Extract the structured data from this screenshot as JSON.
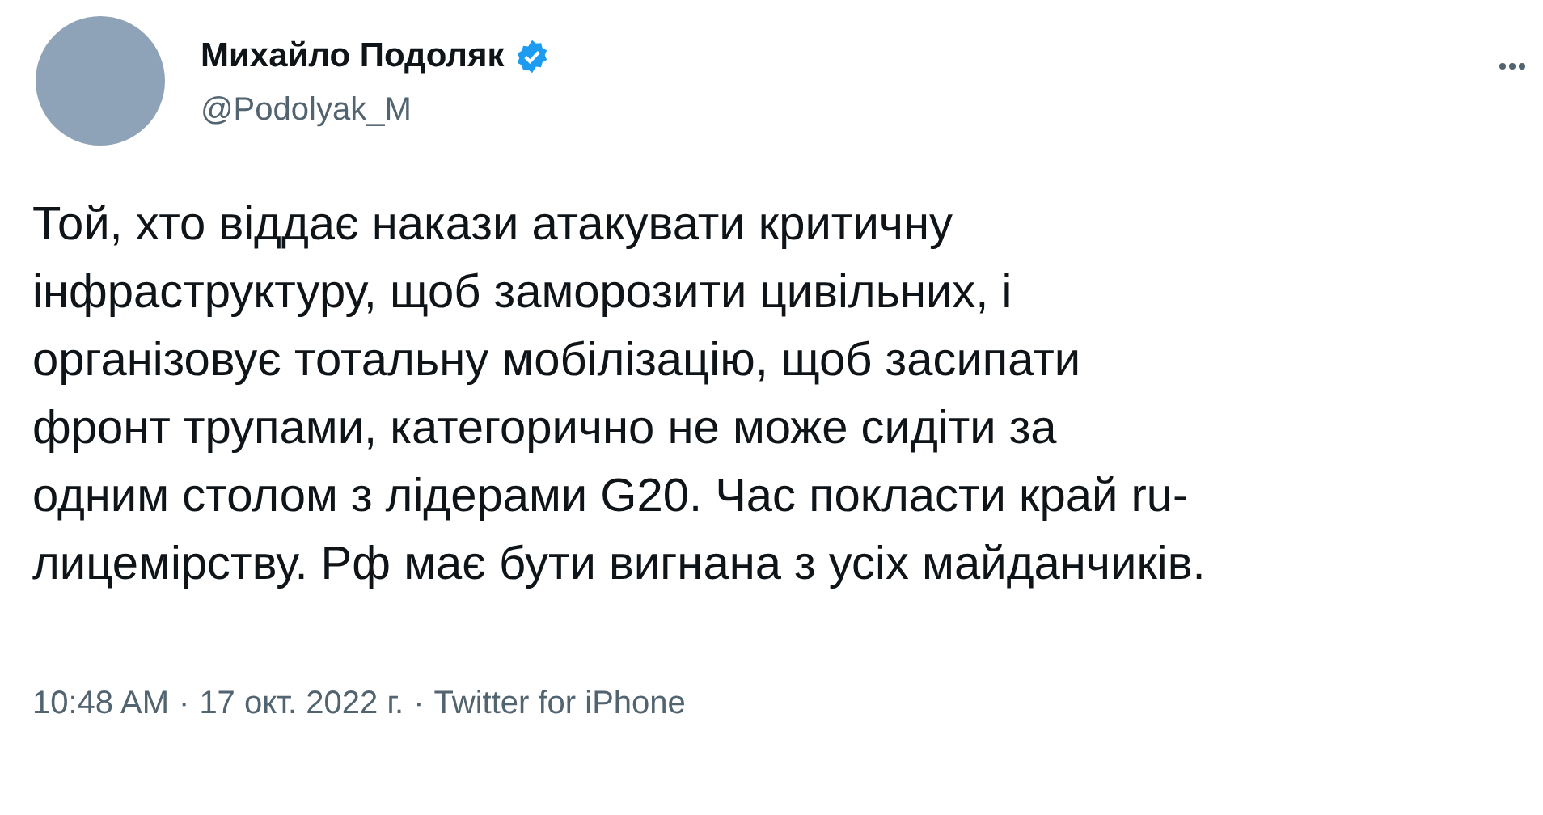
{
  "author": {
    "name": "Михайло Подоляк",
    "verified": true,
    "handle": "@Podolyak_M"
  },
  "tweet": {
    "lines": [
      "Той, хто віддає накази атакувати критичну",
      "інфраструктуру, щоб заморозити цивільних, і",
      "організовує тотальну мобілізацію, щоб засипати",
      "фронт трупами, категорично не може сидіти за",
      "одним столом з лідерами G20. Час покласти край ru-",
      "лицемірству. Рф має бути вигнана з усіх майданчиків."
    ]
  },
  "meta": {
    "time": "10:48 AM",
    "separator_1": "·",
    "date": "17 окт. 2022 г.",
    "separator_2": "·",
    "source": "Twitter for iPhone"
  }
}
